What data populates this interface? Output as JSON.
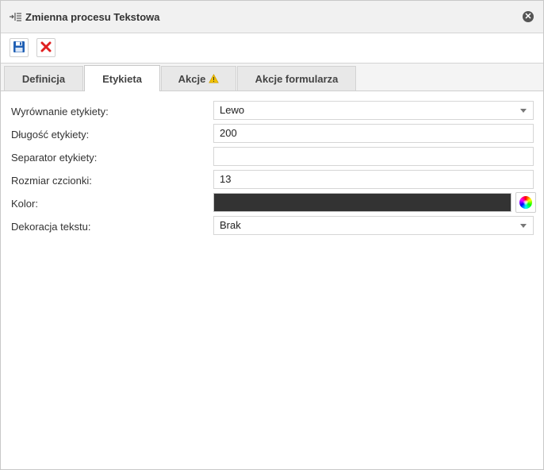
{
  "dialog": {
    "title": "Zmienna procesu Tekstowa",
    "title_icon": "variable-list-icon",
    "close_icon": "close-icon",
    "close_glyph": "✕"
  },
  "toolbar": {
    "save_icon": "save-icon",
    "cancel_icon": "delete-icon"
  },
  "tabs": [
    {
      "label": "Definicja",
      "active": false
    },
    {
      "label": "Etykieta",
      "active": true
    },
    {
      "label": "Akcje",
      "active": false,
      "icon": "warning-icon"
    },
    {
      "label": "Akcje formularza",
      "active": false
    }
  ],
  "form": {
    "label_alignment": {
      "label": "Wyrównanie etykiety:",
      "value": "Lewo"
    },
    "label_length": {
      "label": "Długość etykiety:",
      "value": "200"
    },
    "label_separator": {
      "label": "Separator etykiety:",
      "value": ""
    },
    "font_size": {
      "label": "Rozmiar czcionki:",
      "value": "13"
    },
    "color": {
      "label": "Kolor:",
      "value": "#333333"
    },
    "text_decoration": {
      "label": "Dekoracja tekstu:",
      "value": "Brak"
    }
  },
  "colors": {
    "titlebar_bg": "#f1f1f1",
    "save_blue": "#1f5fb4",
    "cancel_red": "#e02020",
    "warning_yellow": "#f2c200"
  }
}
